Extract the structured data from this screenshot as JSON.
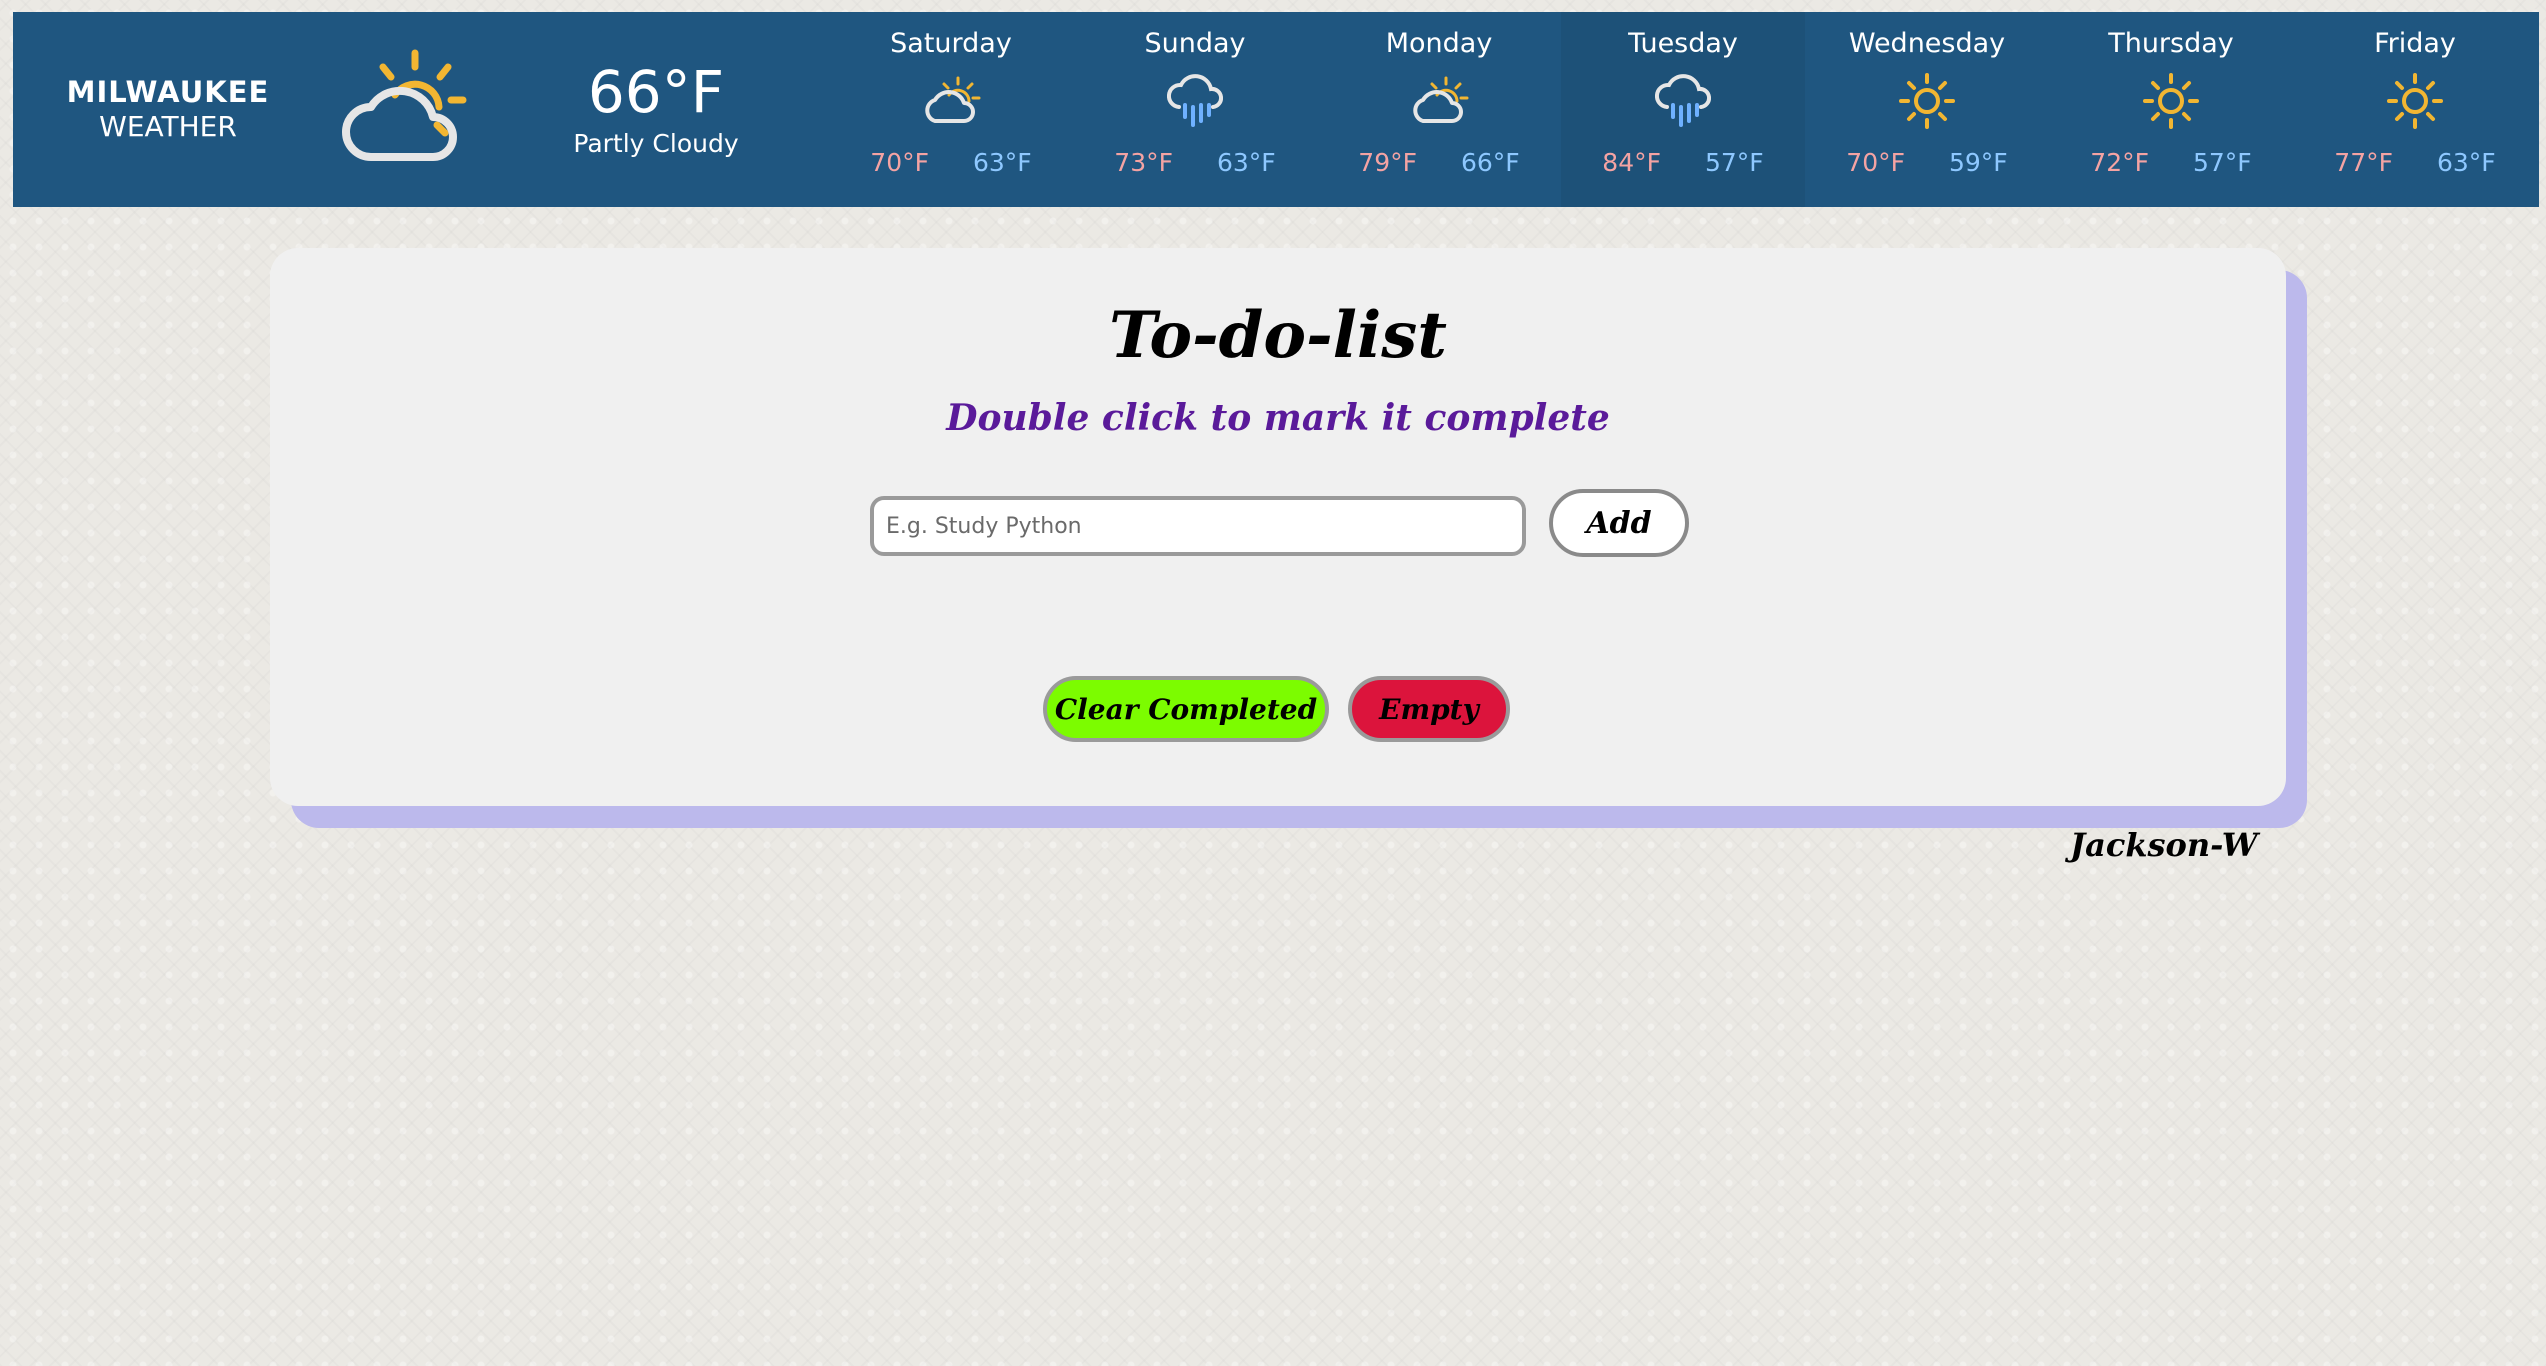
{
  "weather": {
    "city": "MILWAUKEE",
    "subtitle": "WEATHER",
    "current": {
      "temp": "66°F",
      "condition": "Partly Cloudy",
      "icon": "partly-cloudy-icon"
    },
    "forecast": [
      {
        "day": "Saturday",
        "icon": "partly-cloudy-icon",
        "high": "70°F",
        "low": "63°F"
      },
      {
        "day": "Sunday",
        "icon": "rain-icon",
        "high": "73°F",
        "low": "63°F"
      },
      {
        "day": "Monday",
        "icon": "partly-cloudy-icon",
        "high": "79°F",
        "low": "66°F"
      },
      {
        "day": "Tuesday",
        "icon": "rain-icon",
        "high": "84°F",
        "low": "57°F"
      },
      {
        "day": "Wednesday",
        "icon": "sun-icon",
        "high": "70°F",
        "low": "59°F"
      },
      {
        "day": "Thursday",
        "icon": "sun-icon",
        "high": "72°F",
        "low": "57°F"
      },
      {
        "day": "Friday",
        "icon": "sun-icon",
        "high": "77°F",
        "low": "63°F"
      }
    ]
  },
  "todo": {
    "title": "To-do-list",
    "subtitle": "Double click to mark it complete",
    "input": {
      "value": "",
      "placeholder": "E.g. Study Python"
    },
    "add_label": "Add",
    "clear_label": "Clear Completed",
    "empty_label": "Empty"
  },
  "author": "Jackson-W",
  "colors": {
    "weather_bar": "#1f5680",
    "high_temp": "#f4a3a3",
    "low_temp": "#8ec8ff",
    "subtitle": "#5a1a9a",
    "clear_button": "#7cfc00",
    "empty_button": "#dc143c",
    "card_shadow": "#bcb9ec"
  }
}
